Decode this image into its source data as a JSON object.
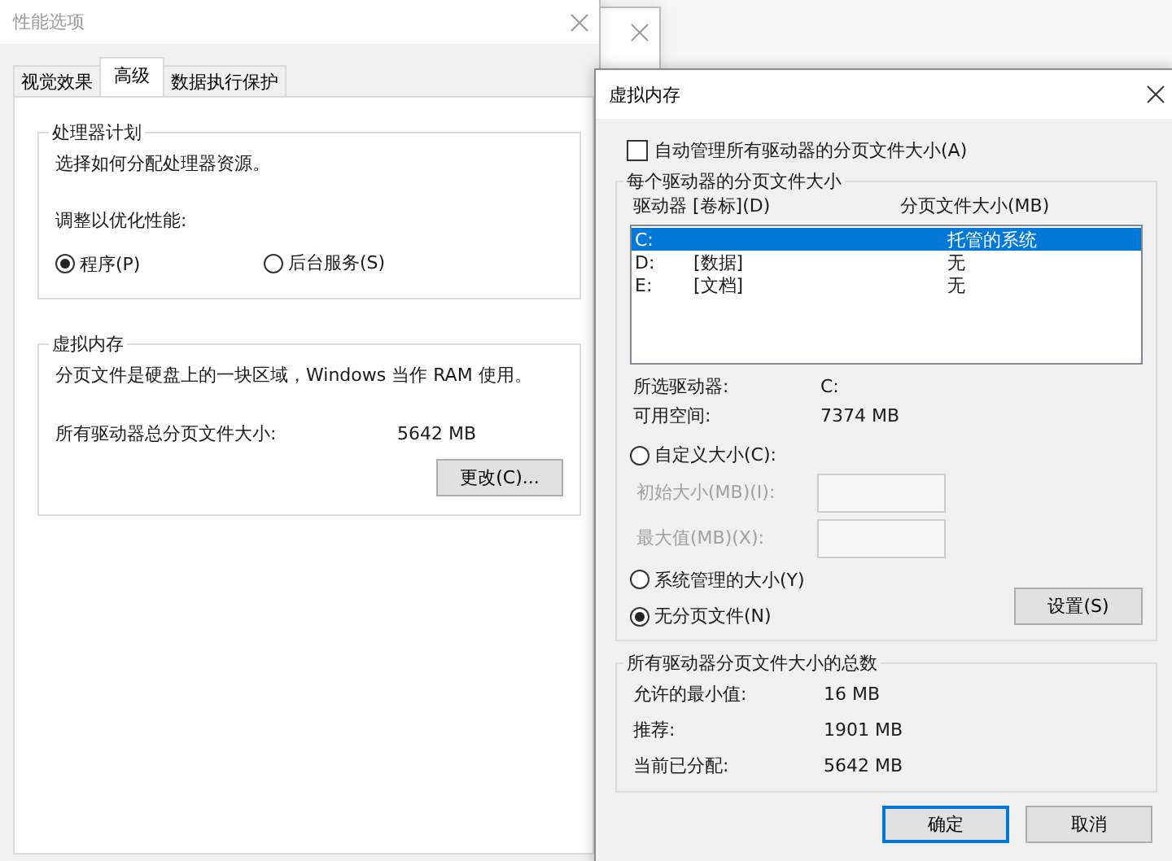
{
  "performance_options": {
    "title": "性能选项",
    "tabs": [
      {
        "label": "视觉效果",
        "selected": false
      },
      {
        "label": "高级",
        "selected": true
      },
      {
        "label": "数据执行保护",
        "selected": false
      }
    ],
    "processor_group": {
      "title": "处理器计划",
      "description": "选择如何分配处理器资源。",
      "adjust_label": "调整以优化性能:",
      "options": [
        {
          "label": "程序(P)",
          "selected": true
        },
        {
          "label": "后台服务(S)",
          "selected": false
        }
      ]
    },
    "memory_group": {
      "title": "虚拟内存",
      "description": "分页文件是硬盘上的一块区域，Windows 当作 RAM 使用。",
      "total_label": "所有驱动器总分页文件大小:",
      "total_value": "5642 MB",
      "change_button": "更改(C)..."
    }
  },
  "virtual_memory": {
    "title": "虚拟内存",
    "auto_manage": {
      "label": "自动管理所有驱动器的分页文件大小(A)",
      "checked": false
    },
    "per_drive_group": {
      "title": "每个驱动器的分页文件大小",
      "columns": [
        "驱动器 [卷标](D)",
        "分页文件大小(MB)"
      ],
      "drives": [
        {
          "drive": "C:",
          "paging_size": "托管的系统",
          "selected": true
        },
        {
          "drive": "D:",
          "volume_label": "[数据]",
          "paging_size": "无",
          "selected": false
        },
        {
          "drive": "E:",
          "volume_label": "[文档]",
          "paging_size": "无",
          "selected": false
        }
      ],
      "info": [
        {
          "label": "所选驱动器:",
          "value": "C:"
        },
        {
          "label": "可用空间:",
          "value": "7374 MB"
        }
      ],
      "size_options": [
        {
          "label": "自定义大小(C):",
          "selected": false,
          "fields": [
            {
              "label": "初始大小(MB)(I):",
              "disabled": true
            },
            {
              "label": "最大值(MB)(X):",
              "disabled": true
            }
          ]
        },
        {
          "label": "系统管理的大小(Y)",
          "selected": false
        },
        {
          "label": "无分页文件(N)",
          "selected": true
        }
      ],
      "set_button": "设置(S)"
    },
    "totals_group": {
      "title": "所有驱动器分页文件大小的总数",
      "rows": [
        {
          "label": "允许的最小值:",
          "value": "16 MB"
        },
        {
          "label": "推荐:",
          "value": "1901 MB"
        },
        {
          "label": "当前已分配:",
          "value": "5642 MB"
        }
      ]
    },
    "buttons": [
      {
        "label": "确定",
        "default": true
      },
      {
        "label": "取消",
        "default": false
      }
    ]
  }
}
